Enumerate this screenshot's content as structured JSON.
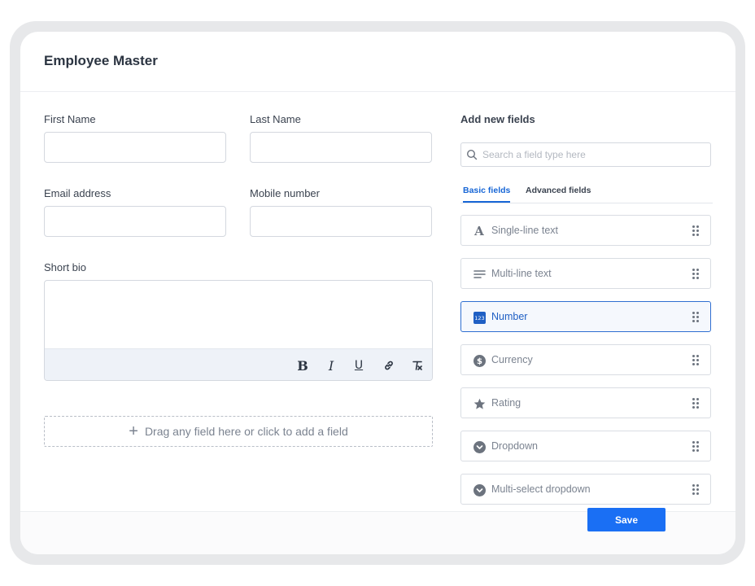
{
  "form": {
    "title": "Employee Master",
    "first_name_label": "First Name",
    "last_name_label": "Last Name",
    "email_label": "Email address",
    "mobile_label": "Mobile number",
    "bio_label": "Short bio",
    "toolbar": [
      "bold-icon",
      "italic-icon",
      "underline-icon",
      "link-icon",
      "clear-format-icon"
    ],
    "dropzone_text": "Drag any field here or click to add a field",
    "save_label": "Save"
  },
  "panel": {
    "title": "Add new fields",
    "search_placeholder": "Search a field type here",
    "tabs": [
      {
        "label": "Basic fields",
        "active": true
      },
      {
        "label": "Advanced fields",
        "active": false
      }
    ],
    "fields": [
      {
        "label": "Single-line text",
        "icon": "text-a-icon",
        "selected": false
      },
      {
        "label": "Multi-line text",
        "icon": "lines-icon",
        "selected": false
      },
      {
        "label": "Number",
        "icon": "number-123-icon",
        "selected": true
      },
      {
        "label": "Currency",
        "icon": "dollar-circle-icon",
        "selected": false
      },
      {
        "label": "Rating",
        "icon": "star-icon",
        "selected": false
      },
      {
        "label": "Dropdown",
        "icon": "chevron-circle-icon",
        "selected": false
      },
      {
        "label": "Multi-select dropdown",
        "icon": "chevron-circle-icon",
        "selected": false
      }
    ]
  },
  "colors": {
    "accent": "#1a6ff4",
    "selected_border": "#2f6fd1",
    "text": "#2b3441",
    "muted": "#7b8390"
  }
}
